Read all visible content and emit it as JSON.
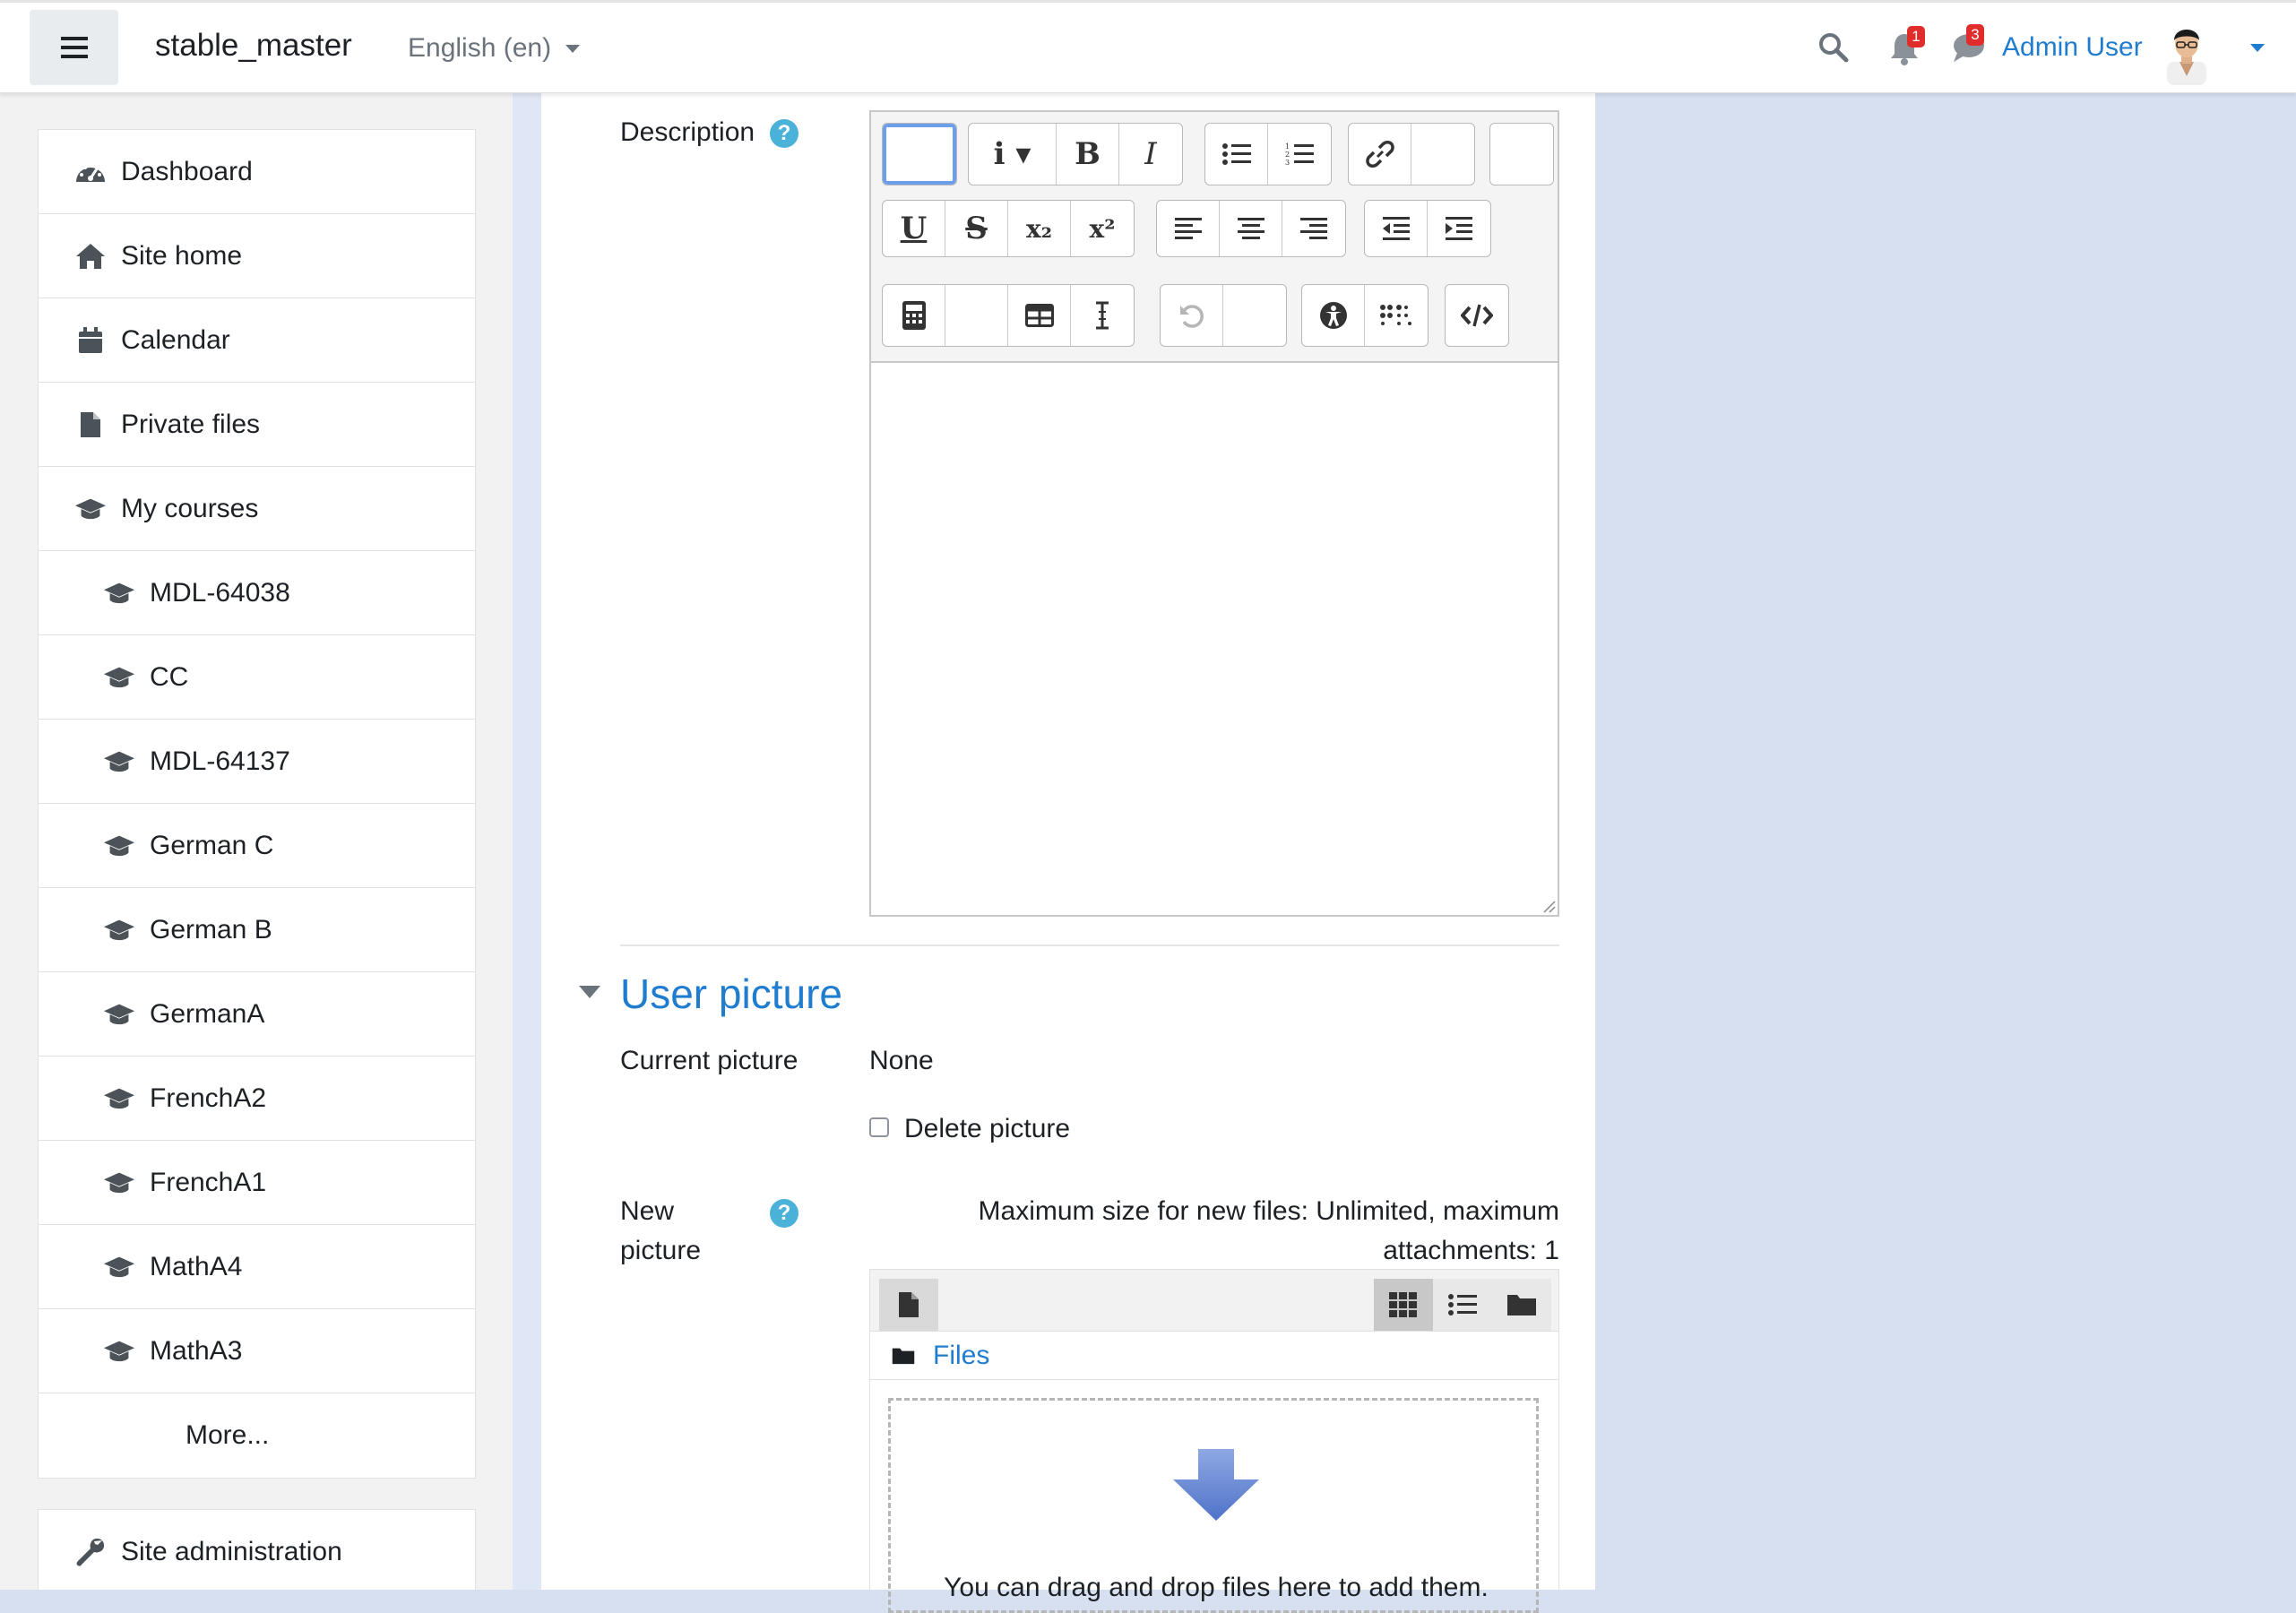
{
  "navbar": {
    "site_name": "stable_master",
    "language": "English (en)",
    "notifications_count": "1",
    "messages_count": "3",
    "user_name": "Admin User"
  },
  "drawer": {
    "items": [
      {
        "label": "Dashboard",
        "icon": "dashboard-icon"
      },
      {
        "label": "Site home",
        "icon": "home-icon"
      },
      {
        "label": "Calendar",
        "icon": "calendar-icon"
      },
      {
        "label": "Private files",
        "icon": "file-icon"
      },
      {
        "label": "My courses",
        "icon": "graduation-cap-icon"
      }
    ],
    "courses": [
      "MDL-64038",
      "CC",
      "MDL-64137",
      "German C",
      "German B",
      "GermanA",
      "FrenchA2",
      "FrenchA1",
      "MathA4",
      "MathA3"
    ],
    "more": "More...",
    "site_admin": "Site administration"
  },
  "form": {
    "description_label": "Description",
    "section_title": "User picture",
    "current_picture_label": "Current picture",
    "current_picture_value": "None",
    "delete_picture_label": "Delete picture",
    "new_picture_label": "New picture",
    "max_size_note": "Maximum size for new files: Unlimited, maximum attachments: 1",
    "files_link": "Files",
    "drop_text": "You can drag and drop files here to add them."
  },
  "colors": {
    "accent": "#1f7ccf",
    "badge": "#e12c2c",
    "help": "#4ab2d8",
    "page_bg": "#d6e0f0"
  }
}
